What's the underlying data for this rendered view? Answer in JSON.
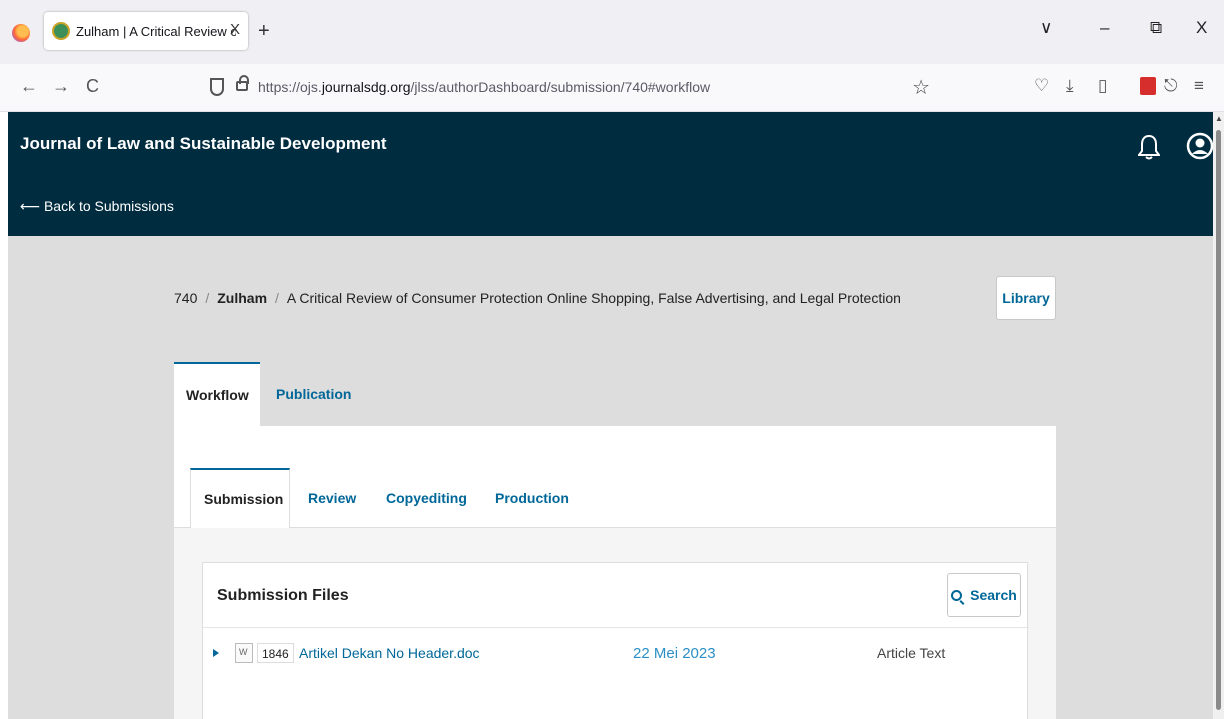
{
  "browser": {
    "tab_title": "Zulham | A Critical Review of C",
    "tab_close": "X",
    "new_tab": "+",
    "url_prefix": "https://ojs.",
    "url_domain": "journalsdg.org",
    "url_path": "/jlss/authorDashboard/submission/740#workflow",
    "window_controls": {
      "menu": "∨",
      "minimize": "–",
      "restore": "⧉",
      "close": "X"
    },
    "nav": {
      "back": "←",
      "forward": "→",
      "reload": "C"
    },
    "star": "☆",
    "icons": [
      "pocket-icon",
      "download-icon",
      "reader-icon",
      "pdf-extension-icon",
      "share-icon",
      "menu-icon"
    ]
  },
  "header": {
    "journal_title": "Journal of Law and Sustainable Development",
    "back_link": "⟵ Back to Submissions",
    "icons": [
      "bell-icon",
      "user-icon"
    ],
    "background": "#002c40"
  },
  "breadcrumb": {
    "id": "740",
    "sep": "/",
    "author": "Zulham",
    "title": "A Critical Review of Consumer Protection Online Shopping, False Advertising, and Legal Protection"
  },
  "library_label": "Library",
  "main_tabs": [
    {
      "label": "Workflow",
      "active": true
    },
    {
      "label": "Publication",
      "active": false
    }
  ],
  "sub_tabs": [
    {
      "label": "Submission",
      "active": true
    },
    {
      "label": "Review",
      "active": false
    },
    {
      "label": "Copyediting",
      "active": false
    },
    {
      "label": "Production",
      "active": false
    }
  ],
  "submission_files": {
    "title": "Submission Files",
    "search_label": "Search",
    "rows": [
      {
        "id": "1846",
        "name": "Artikel Dekan No Header.doc",
        "date": "22 Mei 2023",
        "type": "Article Text"
      }
    ]
  },
  "colors": {
    "accent": "#006798",
    "header_bg": "#002c40",
    "date_text": "#2a8fc4"
  }
}
